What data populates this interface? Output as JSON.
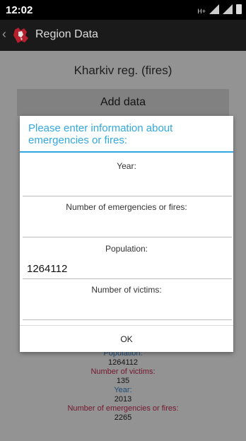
{
  "status": {
    "time": "12:02",
    "network": "H+"
  },
  "action_bar": {
    "title": "Region Data",
    "back_glyph": "‹"
  },
  "page": {
    "region_title": "Kharkiv reg. (fires)",
    "add_button": "Add data"
  },
  "dialog": {
    "title": "Please enter information about emergencies or fires:",
    "fields": [
      {
        "label": "Year:",
        "value": "",
        "placeholder": ""
      },
      {
        "label": "Number of emergencies or fires:",
        "value": "",
        "placeholder": ""
      },
      {
        "label": "Population:",
        "value": "1264112",
        "placeholder": ""
      },
      {
        "label": "Number of victims:",
        "value": "",
        "placeholder": ""
      }
    ],
    "ok": "OK"
  },
  "list": {
    "population_label": "Population:",
    "population_value": "1264112",
    "victims_label": "Number of victims:",
    "victims_value": "135",
    "year_label": "Year:",
    "year_value": "2013",
    "emergencies_label": "Number of emergencies or fires:",
    "emergencies_value": "2265"
  },
  "colors": {
    "accent": "#33a8e0",
    "label_red": "#c0284f",
    "label_blue": "#2f7ec7"
  },
  "icons": {
    "app": "app-logo-icon",
    "back": "chevron-left-icon",
    "signal": "signal-icon",
    "battery": "battery-icon"
  }
}
